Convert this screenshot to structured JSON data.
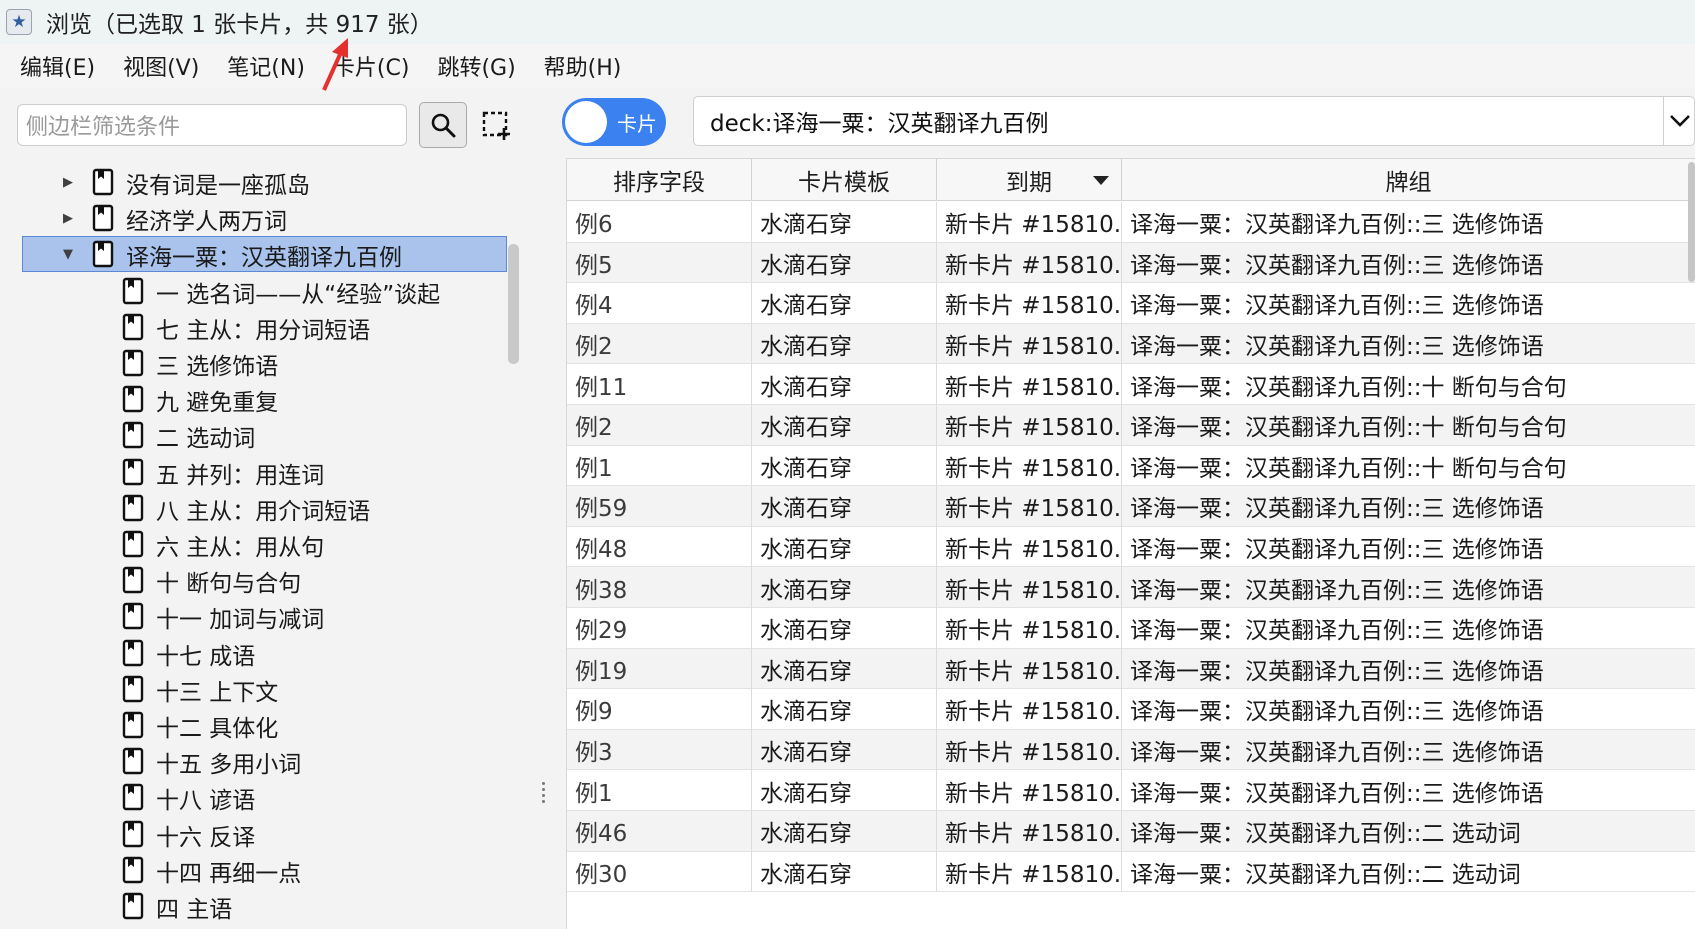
{
  "titlebar": {
    "title": "浏览（已选取 1 张卡片，共 917 张）",
    "icon": "anki-star-icon"
  },
  "menu": [
    "编辑(E)",
    "视图(V)",
    "笔记(N)",
    "卡片(C)",
    "跳转(G)",
    "帮助(H)"
  ],
  "sidebar": {
    "search_placeholder": "侧边栏筛选条件",
    "tree": [
      {
        "label": "没有词是一座孤岛",
        "level": 0,
        "expander": "collapsed"
      },
      {
        "label": "经济学人两万词",
        "level": 0,
        "expander": "collapsed"
      },
      {
        "label": "译海一粟：汉英翻译九百例",
        "level": 0,
        "expander": "expanded",
        "selected": true
      },
      {
        "label": "一 选名词——从“经验”谈起",
        "level": 1
      },
      {
        "label": "七 主从：用分词短语",
        "level": 1
      },
      {
        "label": "三 选修饰语",
        "level": 1
      },
      {
        "label": "九 避免重复",
        "level": 1
      },
      {
        "label": "二 选动词",
        "level": 1
      },
      {
        "label": "五 并列：用连词",
        "level": 1
      },
      {
        "label": "八 主从：用介词短语",
        "level": 1
      },
      {
        "label": "六 主从：用从句",
        "level": 1
      },
      {
        "label": "十 断句与合句",
        "level": 1
      },
      {
        "label": "十一 加词与减词",
        "level": 1
      },
      {
        "label": "十七 成语",
        "level": 1
      },
      {
        "label": "十三 上下文",
        "level": 1
      },
      {
        "label": "十二 具体化",
        "level": 1
      },
      {
        "label": "十五 多用小词",
        "level": 1
      },
      {
        "label": "十八 谚语",
        "level": 1
      },
      {
        "label": "十六 反译",
        "level": 1
      },
      {
        "label": "十四 再细一点",
        "level": 1
      },
      {
        "label": "四 主语",
        "level": 1
      }
    ]
  },
  "toolbar": {
    "mode_label": "卡片",
    "query": "deck:译海一粟：汉英翻译九百例"
  },
  "table": {
    "columns": [
      "排序字段",
      "卡片模板",
      "到期",
      "牌组"
    ],
    "sort_column": 2,
    "rows": [
      [
        "例6",
        "水滴石穿",
        "新卡片 #15810...",
        "译海一粟：汉英翻译九百例::三 选修饰语"
      ],
      [
        "例5",
        "水滴石穿",
        "新卡片 #15810...",
        "译海一粟：汉英翻译九百例::三 选修饰语"
      ],
      [
        "例4",
        "水滴石穿",
        "新卡片 #15810...",
        "译海一粟：汉英翻译九百例::三 选修饰语"
      ],
      [
        "例2",
        "水滴石穿",
        "新卡片 #15810...",
        "译海一粟：汉英翻译九百例::三 选修饰语"
      ],
      [
        "例11",
        "水滴石穿",
        "新卡片 #15810...",
        "译海一粟：汉英翻译九百例::十 断句与合句"
      ],
      [
        "例2",
        "水滴石穿",
        "新卡片 #15810...",
        "译海一粟：汉英翻译九百例::十 断句与合句"
      ],
      [
        "例1",
        "水滴石穿",
        "新卡片 #15810...",
        "译海一粟：汉英翻译九百例::十 断句与合句"
      ],
      [
        "例59",
        "水滴石穿",
        "新卡片 #15810...",
        "译海一粟：汉英翻译九百例::三 选修饰语"
      ],
      [
        "例48",
        "水滴石穿",
        "新卡片 #15810...",
        "译海一粟：汉英翻译九百例::三 选修饰语"
      ],
      [
        "例38",
        "水滴石穿",
        "新卡片 #15810...",
        "译海一粟：汉英翻译九百例::三 选修饰语"
      ],
      [
        "例29",
        "水滴石穿",
        "新卡片 #15810...",
        "译海一粟：汉英翻译九百例::三 选修饰语"
      ],
      [
        "例19",
        "水滴石穿",
        "新卡片 #15810...",
        "译海一粟：汉英翻译九百例::三 选修饰语"
      ],
      [
        "例9",
        "水滴石穿",
        "新卡片 #15810...",
        "译海一粟：汉英翻译九百例::三 选修饰语"
      ],
      [
        "例3",
        "水滴石穿",
        "新卡片 #15810...",
        "译海一粟：汉英翻译九百例::三 选修饰语"
      ],
      [
        "例1",
        "水滴石穿",
        "新卡片 #15810...",
        "译海一粟：汉英翻译九百例::三 选修饰语"
      ],
      [
        "例46",
        "水滴石穿",
        "新卡片 #15810...",
        "译海一粟：汉英翻译九百例::二 选动词"
      ],
      [
        "例30",
        "水滴石穿",
        "新卡片 #15810...",
        "译海一粟：汉英翻译九百例::二 选动词"
      ]
    ]
  },
  "colors": {
    "accent": "#3b82f0",
    "selection": "#a9c3ec",
    "annotation_arrow": "#e53030"
  }
}
